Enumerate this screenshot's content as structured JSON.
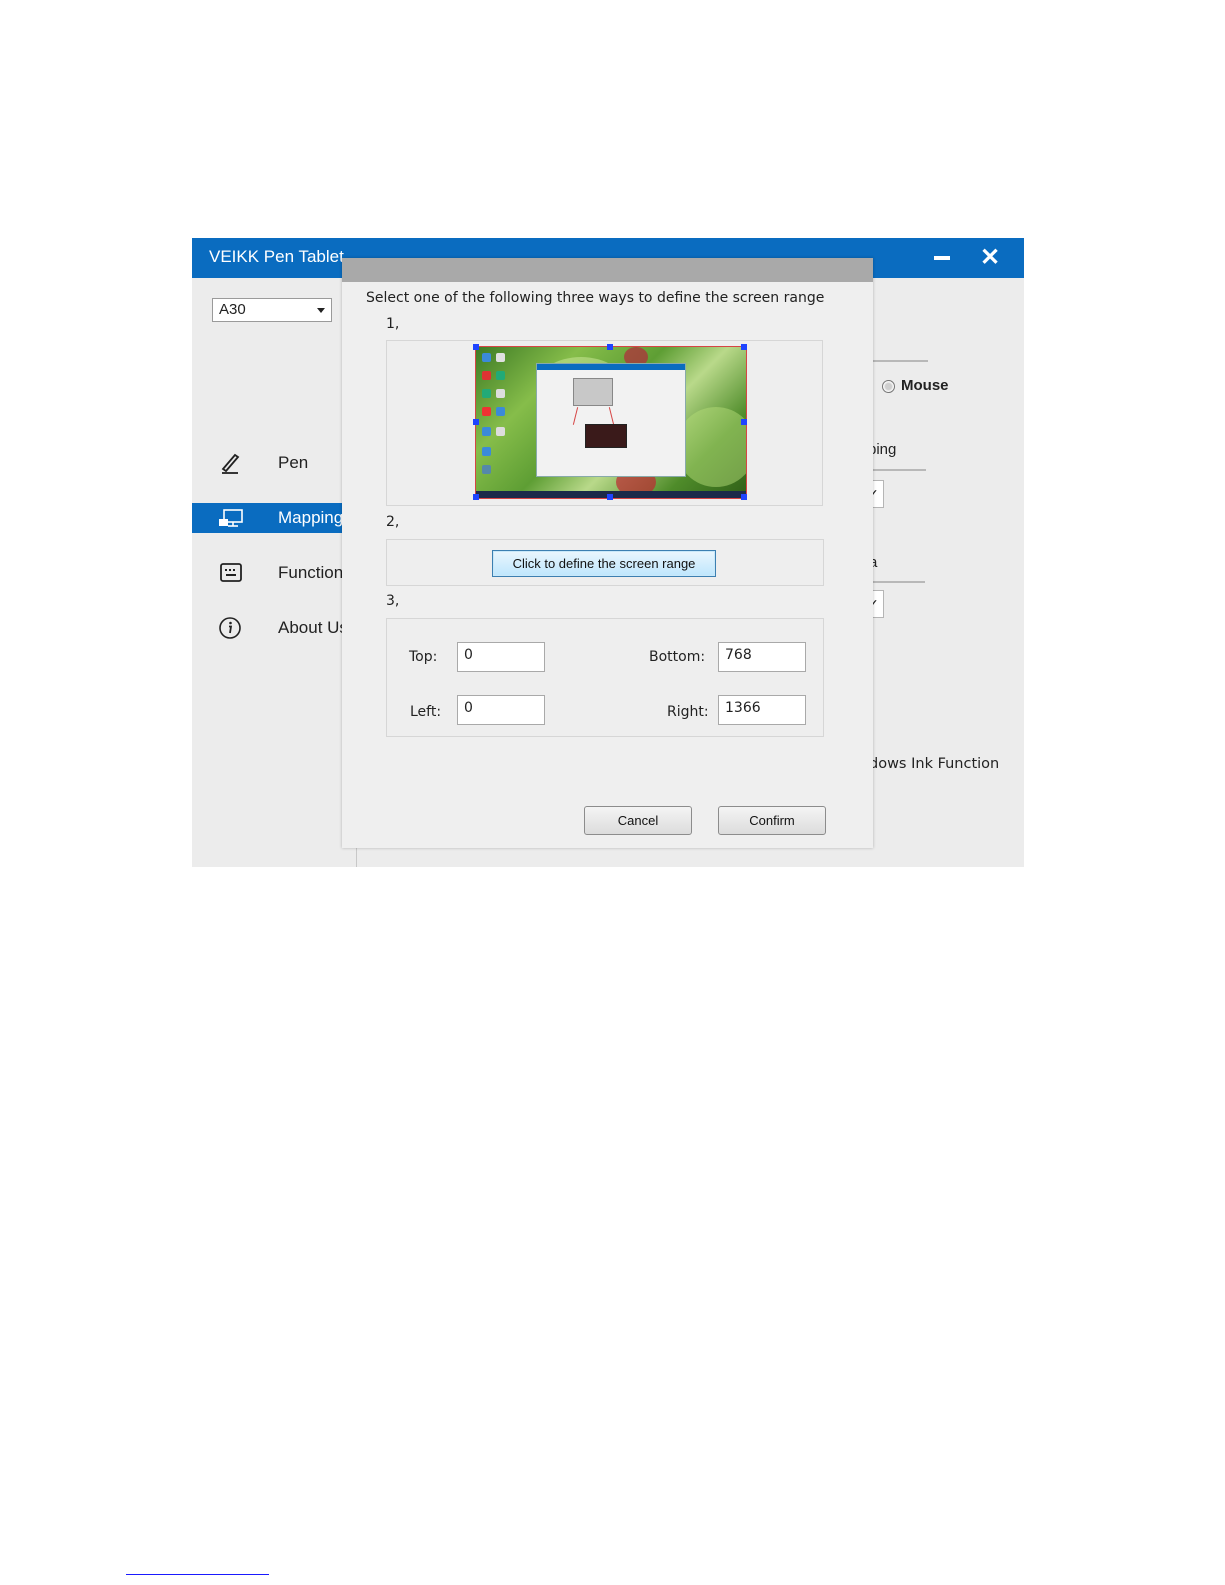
{
  "window": {
    "title": "VEIKK Pen Tablet",
    "device_selected": "A30"
  },
  "sidebar": {
    "items": [
      {
        "label": "Pen",
        "icon": "pen-icon"
      },
      {
        "label": "Mapping",
        "icon": "monitor-icon",
        "active": true
      },
      {
        "label": "Function",
        "icon": "keyboard-icon"
      },
      {
        "label": "About Us",
        "icon": "info-icon"
      }
    ]
  },
  "background_panel": {
    "mouse_label": "Mouse",
    "mapping_partial": "ping",
    "area_partial": "a",
    "windows_ink_partial": "dows Ink Function"
  },
  "dialog": {
    "instruction": "Select one of the following three ways to define the screen range",
    "step1_label": "1,",
    "step2_label": "2,",
    "step3_label": "3,",
    "define_button": "Click to define the screen range",
    "fields": {
      "top_label": "Top:",
      "top_value": "0",
      "bottom_label": "Bottom:",
      "bottom_value": "768",
      "left_label": "Left:",
      "left_value": "0",
      "right_label": "Right:",
      "right_value": "1366"
    },
    "cancel_label": "Cancel",
    "confirm_label": "Confirm"
  },
  "colors": {
    "accent": "#0a6cc0",
    "dialog_header": "#a9a9a9",
    "selection_border": "#d64545",
    "handle": "#1e44ff"
  }
}
